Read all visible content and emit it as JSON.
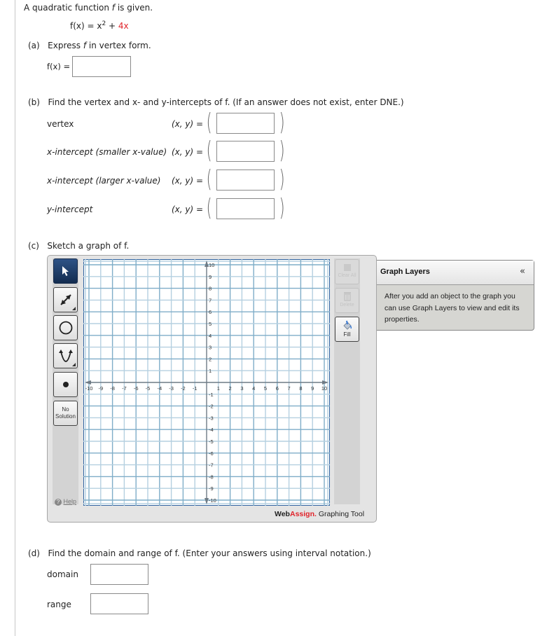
{
  "intro": {
    "text": "A quadratic function ",
    "var": "f",
    "text2": " is given."
  },
  "function": {
    "lhs": "f(x) = x",
    "exp": "2",
    "plus": " + ",
    "coef": "4x"
  },
  "part_a": {
    "label": "(a)",
    "prompt_pre": "Express ",
    "prompt_var": "f",
    "prompt_post": " in vertex form.",
    "field_label": "f(x) =",
    "value": ""
  },
  "part_b": {
    "label": "(b)",
    "prompt": "Find the vertex and x- and y-intercepts of f. (If an answer does not exist, enter DNE.)",
    "xy_label": "(x, y) =",
    "rows": [
      {
        "label": "vertex",
        "value": ""
      },
      {
        "label": "x-intercept (smaller x-value)",
        "value": ""
      },
      {
        "label": "x-intercept (larger x-value)",
        "value": ""
      },
      {
        "label": "y-intercept",
        "value": ""
      }
    ]
  },
  "part_c": {
    "label": "(c)",
    "prompt": "Sketch a graph of f."
  },
  "graph_tool": {
    "tools": [
      {
        "name": "select",
        "icon": "pointer-arrow-icon",
        "active": true
      },
      {
        "name": "line",
        "icon": "line-arrows-icon",
        "active": false
      },
      {
        "name": "circle",
        "icon": "circle-icon",
        "active": false
      },
      {
        "name": "parabola",
        "icon": "parabola-icon",
        "active": false
      },
      {
        "name": "point",
        "icon": "point-icon",
        "active": false
      }
    ],
    "no_solution_line1": "No",
    "no_solution_line2": "Solution",
    "help_label": "Help",
    "clear_all_label": "Clear All",
    "delete_label": "Delete",
    "fill_label": "Fill",
    "brand_web": "Web",
    "brand_assign": "Assign.",
    "brand_suffix": " Graphing Tool",
    "brand_color": "#e0242b",
    "axis": {
      "xmin": -10,
      "xmax": 10,
      "ymin": -10,
      "ymax": 10,
      "step": 1,
      "x_ticks": [
        "-10",
        "-9",
        "-8",
        "-7",
        "-6",
        "-5",
        "-4",
        "-3",
        "-2",
        "-1",
        "1",
        "2",
        "3",
        "4",
        "5",
        "6",
        "7",
        "8",
        "9",
        "10"
      ],
      "y_ticks": [
        "10",
        "9",
        "8",
        "7",
        "6",
        "5",
        "4",
        "3",
        "2",
        "1",
        "-1",
        "-2",
        "-3",
        "-4",
        "-5",
        "-6",
        "-7",
        "-8",
        "-9",
        "-10"
      ]
    }
  },
  "graph_layers": {
    "title": "Graph Layers",
    "collapse_icon": "«",
    "body": "After you add an object to the graph you can use Graph Layers to view and edit its properties."
  },
  "part_d": {
    "label": "(d)",
    "prompt": "Find the domain and range of f. (Enter your answers using interval notation.)",
    "domain_label": "domain",
    "domain_value": "",
    "range_label": "range",
    "range_value": ""
  }
}
